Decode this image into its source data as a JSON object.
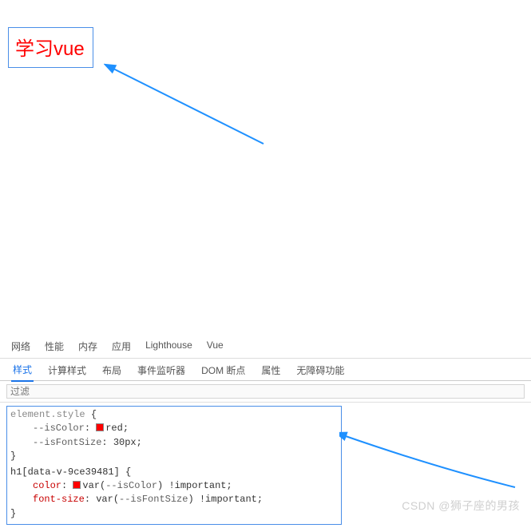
{
  "header": {
    "rendered_text": "学习vue"
  },
  "devtools": {
    "main_tabs": [
      "网络",
      "性能",
      "内存",
      "应用",
      "Lighthouse",
      "Vue"
    ],
    "sub_tabs": [
      "样式",
      "计算样式",
      "布局",
      "事件监听器",
      "DOM 断点",
      "属性",
      "无障碍功能"
    ],
    "active_sub_tab": "样式",
    "filter_placeholder": "过滤"
  },
  "styles": {
    "rule1": {
      "selector": "element.style",
      "open": "{",
      "decl1_name": "--isColor",
      "decl1_value": "red",
      "decl2_name": "--isFontSize",
      "decl2_value": "30px",
      "close": "}"
    },
    "rule2": {
      "selector": "h1[data-v-9ce39481]",
      "open": "{",
      "decl1_name": "color",
      "decl1_var": "var",
      "decl1_arg": "--isColor",
      "decl1_important": "!important",
      "decl2_name": "font-size",
      "decl2_var": "var",
      "decl2_arg": "--isFontSize",
      "decl2_important": "!important",
      "close": "}"
    }
  },
  "watermark": "CSDN @狮子座的男孩",
  "colors": {
    "accent": "#1a73e8",
    "red": "#ff0000",
    "arrow": "#1e90ff"
  }
}
